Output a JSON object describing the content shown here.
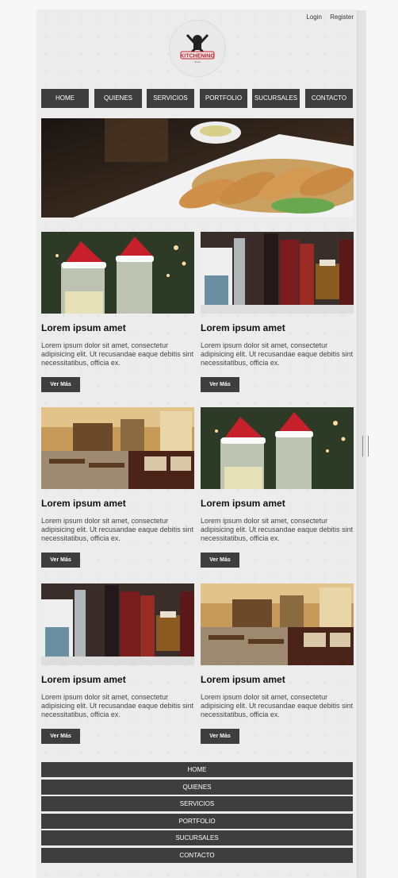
{
  "header": {
    "login": "Login",
    "register": "Register"
  },
  "logo": {
    "text": "KITCHENING",
    "sub": "Since"
  },
  "nav": [
    "HOME",
    "QUIENES",
    "SERVICIOS",
    "PORTFOLIO",
    "SUCURSALES",
    "CONTACTO"
  ],
  "cards": [
    {
      "title": "Lorem ipsum amet",
      "text": "Lorem ipsum dolor sit amet, consectetur adipisicing elit. Ut recusandae eaque debitis sint necessitatibus, officia ex.",
      "button": "Ver Más",
      "image": "christmas-champagne"
    },
    {
      "title": "Lorem ipsum amet",
      "text": "Lorem ipsum dolor sit amet, consectetur adipisicing elit. Ut recusandae eaque debitis sint necessitatibus, officia ex.",
      "button": "Ver Más",
      "image": "deli-products"
    },
    {
      "title": "Lorem ipsum amet",
      "text": "Lorem ipsum dolor sit amet, consectetur adipisicing elit. Ut recusandae eaque debitis sint necessitatibus, officia ex.",
      "button": "Ver Más",
      "image": "restaurant-interior"
    },
    {
      "title": "Lorem ipsum amet",
      "text": "Lorem ipsum dolor sit amet, consectetur adipisicing elit. Ut recusandae eaque debitis sint necessitatibus, officia ex.",
      "button": "Ver Más",
      "image": "christmas-champagne"
    },
    {
      "title": "Lorem ipsum amet",
      "text": "Lorem ipsum dolor sit amet, consectetur adipisicing elit. Ut recusandae eaque debitis sint necessitatibus, officia ex.",
      "button": "Ver Más",
      "image": "deli-products"
    },
    {
      "title": "Lorem ipsum amet",
      "text": "Lorem ipsum dolor sit amet, consectetur adipisicing elit. Ut recusandae eaque debitis sint necessitatibus, officia ex.",
      "button": "Ver Más",
      "image": "restaurant-interior"
    }
  ],
  "colors": {
    "nav_bg": "#3e3e3e",
    "nav_text": "#ffffff",
    "page_bg": "#ececec",
    "logo_red": "#c8202a"
  }
}
